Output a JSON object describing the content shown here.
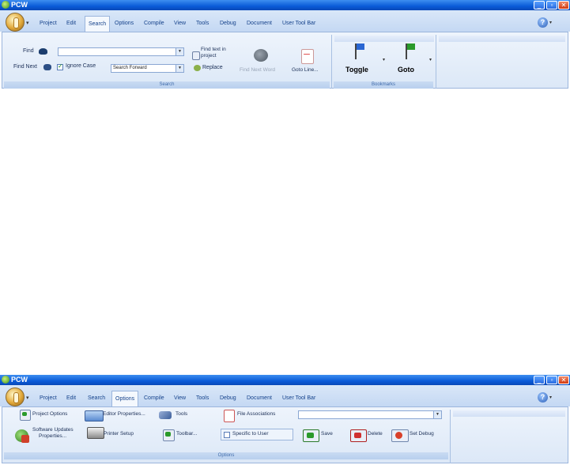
{
  "app": {
    "title": "PCW"
  },
  "tabs": [
    "Project",
    "Edit",
    "Search",
    "Options",
    "Compile",
    "View",
    "Tools",
    "Debug",
    "Document",
    "User Tool Bar"
  ],
  "search_ribbon": {
    "find_label": "Find",
    "find_next_label": "Find Next",
    "ignore_case_label": "Ignore Case",
    "ignore_case_checked": true,
    "direction_value": "Search Forward",
    "find_in_project_label": "Find text in project",
    "replace_label": "Replace",
    "find_next_word_label": "Find Next Word",
    "goto_line_label": "Goto Line...",
    "search_group_caption": "Search",
    "toggle_label": "Toggle",
    "goto_label": "Goto",
    "bookmarks_group_caption": "Bookmarks"
  },
  "options_ribbon": {
    "project_options_label": "Project Options",
    "editor_properties_label": "Editor Properties...",
    "tools_label": "Tools",
    "file_associations_label": "File Associations",
    "software_updates_label_1": "Software Updates",
    "software_updates_label_2": "Properties...",
    "printer_setup_label": "Printer Setup",
    "toolbar_label": "Toolbar...",
    "specific_to_user_label": "Specific to User",
    "save_label": "Save",
    "delete_label": "Delete",
    "set_debug_label": "Set Debug",
    "options_group_caption": "Options"
  },
  "colors": {
    "accent": "#15428b",
    "titlebar": "#0a5bd8"
  }
}
